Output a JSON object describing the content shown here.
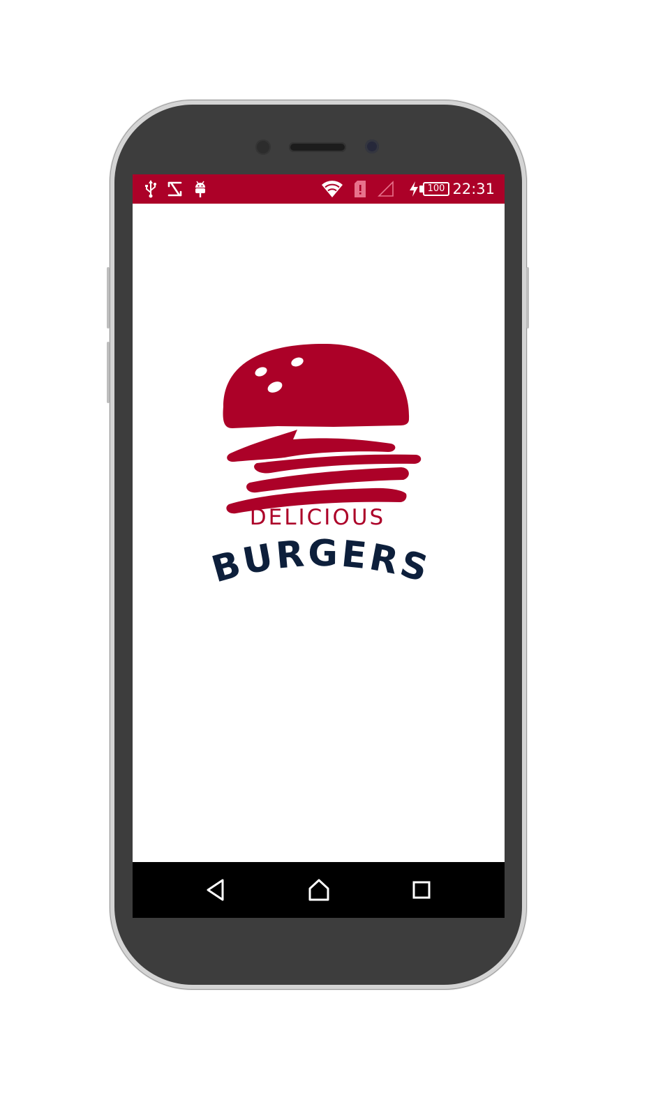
{
  "status_bar": {
    "time": "22:31",
    "battery_level": "100",
    "background_color": "#ac0128",
    "left_icons": [
      "usb-icon",
      "s-app-icon",
      "android-debug-icon"
    ],
    "right_icons": [
      "wifi-icon",
      "sim-alert-icon",
      "signal-icon",
      "charging-icon",
      "battery-icon"
    ]
  },
  "splash": {
    "brand_line1": "DELICIOUS",
    "brand_line2": "BURGERS",
    "brand_colors": {
      "primary": "#ac0128",
      "secondary": "#0d1f3b"
    }
  },
  "nav_bar": {
    "buttons": [
      "back-icon",
      "home-icon",
      "recents-icon"
    ]
  }
}
